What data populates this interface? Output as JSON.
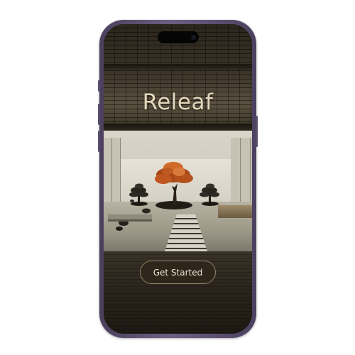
{
  "app": {
    "title": "Releaf"
  },
  "cta": {
    "label": "Get Started"
  },
  "colors": {
    "title": "#e3d8bc",
    "button_background": "#2e261b",
    "button_border": "#8f8468",
    "maple_accent": "#c85a1e",
    "frame": "#5a4e6e"
  },
  "icons": {
    "camera": "front-camera-icon"
  }
}
